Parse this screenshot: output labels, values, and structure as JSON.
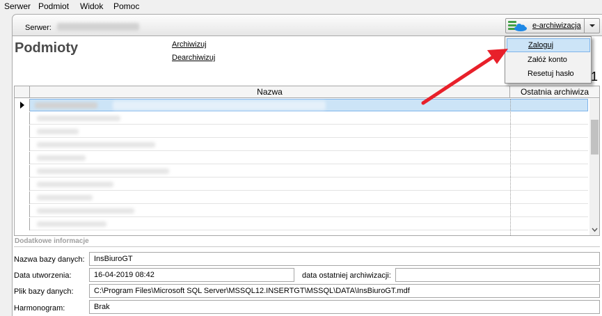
{
  "menu": [
    "Serwer",
    "Podmiot",
    "Widok",
    "Pomoc"
  ],
  "server_label": "Serwer:",
  "earch": {
    "label": "e-archiwizacja",
    "icon": "database-cloud-icon",
    "accent": "#2e7d32",
    "dropdown": [
      "Zaloguj",
      "Załóż konto",
      "Resetuj hasło"
    ]
  },
  "panel_title": "Podmioty",
  "actions": [
    "Archiwizuj",
    "Dearchiwizuj"
  ],
  "page_number": "1",
  "grid": {
    "columns": [
      "Nazwa",
      "Ostatnia archiwiza"
    ],
    "selected_row_color": "#cce4f7"
  },
  "details": {
    "section": "Dodatkowe informacje",
    "db_name_label": "Nazwa bazy danych:",
    "db_name": "InsBiuroGT",
    "created_label": "Data utworzenia:",
    "created": "16-04-2019 08:42",
    "last_arch_label": "data ostatniej archiwizacji:",
    "last_arch": "",
    "file_label": "Plik bazy danych:",
    "file": "C:\\Program Files\\Microsoft SQL Server\\MSSQL12.INSERTGT\\MSSQL\\DATA\\InsBiuroGT.mdf",
    "schedule_label": "Harmonogram:",
    "schedule": "Brak"
  }
}
